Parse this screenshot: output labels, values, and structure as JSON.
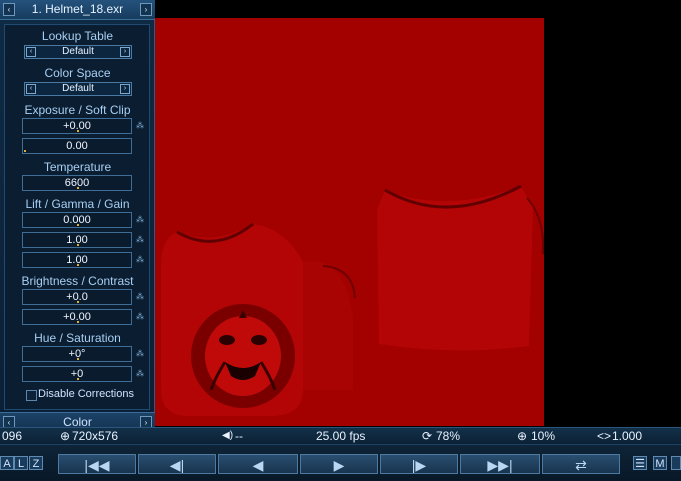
{
  "panel": {
    "title": "1. Helmet_18.exr",
    "lookup_table_label": "Lookup Table",
    "lookup_table_value": "Default",
    "color_space_label": "Color Space",
    "color_space_value": "Default",
    "exposure_label": "Exposure / Soft Clip",
    "exposure_value": "+0.00",
    "soft_clip_value": "0.00",
    "temperature_label": "Temperature",
    "temperature_value": "6600",
    "lgg_label": "Lift / Gamma / Gain",
    "lift_value": "0.000",
    "gamma_value": "1.00",
    "gain_value": "1.00",
    "bc_label": "Brightness / Contrast",
    "brightness_value": "+0.0",
    "contrast_value": "+0.00",
    "hs_label": "Hue / Saturation",
    "hue_value": "+0°",
    "saturation_value": "+0",
    "disable_label": "Disable Corrections",
    "footer_title": "Color"
  },
  "status": {
    "frame": "096",
    "resolution": "720x576",
    "audio": "--",
    "fps": "25.00 fps",
    "cache": "78%",
    "zoom": "10%",
    "aspect": "1.000"
  },
  "toolbar": {
    "mode_a": "A",
    "mode_l": "L",
    "mode_z": "Z",
    "m_button": "M"
  },
  "colors": {
    "image_bg": "#a30000",
    "panel_bg": "#0b2036",
    "accent": "#e0b030"
  }
}
